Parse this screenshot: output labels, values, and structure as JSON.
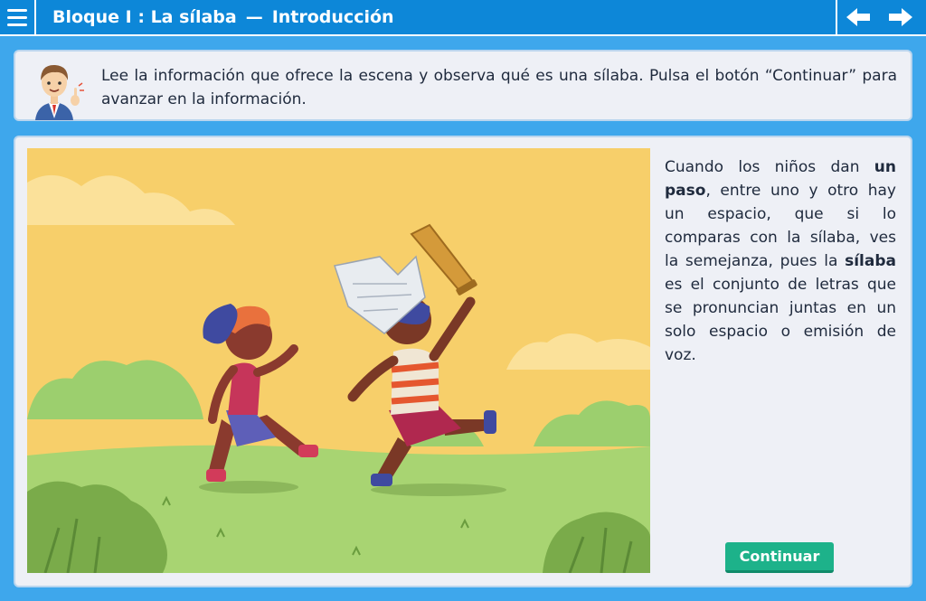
{
  "header": {
    "title": "Bloque I : La sílaba",
    "separator": "—",
    "section": "Introducción",
    "menu_icon": "hamburger-menu-icon",
    "prev_icon": "arrow-left-icon",
    "next_icon": "arrow-right-icon",
    "bar_color": "#0d87d8"
  },
  "instruction": {
    "avatar_icon": "teacher-avatar-icon",
    "text": "Lee la información que ofrece la escena y observa qué es una sílaba. Pulsa el botón “Continuar” para avanzar en la información."
  },
  "explanation": {
    "part1": "Cuando los niños dan ",
    "bold1": "un paso",
    "part2": ", entre uno y otro hay un espacio, que si lo comparas con la sílaba, ves la semejanza, pues la ",
    "bold2": "sílaba",
    "part3": " es el conjunto de letras que se pronuncian juntas en un solo espacio o emisión de voz."
  },
  "buttons": {
    "continue_label": "Continuar",
    "continue_color": "#1db28a"
  },
  "colors": {
    "background": "#3ea7ec",
    "panel": "#eef0f6"
  }
}
